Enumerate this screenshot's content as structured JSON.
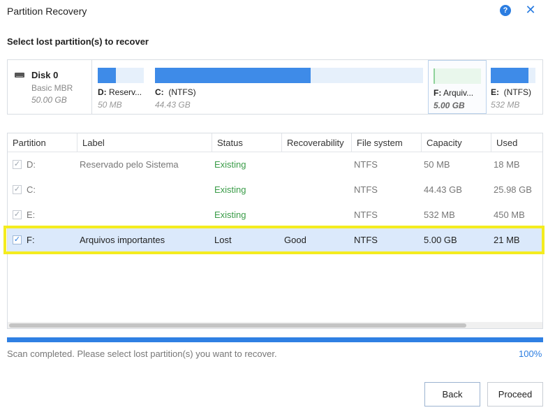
{
  "window": {
    "title": "Partition Recovery",
    "help_icon": "question-circle-icon",
    "close_icon": "close-icon",
    "accent_color": "#2b7de1"
  },
  "section_title": "Select lost partition(s) to recover",
  "disk": {
    "name": "Disk 0",
    "type": "Basic MBR",
    "size": "50.00 GB",
    "icon": "hard-disk-icon"
  },
  "disk_partitions": [
    {
      "letter": "D:",
      "name": "Reserv...",
      "size": "50 MB",
      "used_fraction": 0.4,
      "selected": false
    },
    {
      "letter": "C:",
      "name": "(NTFS)",
      "size": "44.43 GB",
      "used_fraction": 0.58,
      "selected": false
    },
    {
      "letter": "F:",
      "name": "Arquiv...",
      "size": "5.00 GB",
      "used_fraction": 0.03,
      "selected": true
    },
    {
      "letter": "E:",
      "name": "(NTFS)",
      "size": "532 MB",
      "used_fraction": 0.85,
      "selected": false
    }
  ],
  "table": {
    "columns": [
      "Partition",
      "Label",
      "Status",
      "Recoverability",
      "File system",
      "Capacity",
      "Used"
    ],
    "rows": [
      {
        "partition": "D:",
        "label": "Reservado pelo Sistema",
        "status": "Existing",
        "recoverability": "",
        "file_system": "NTFS",
        "capacity": "50 MB",
        "used": "18 MB",
        "checked": true,
        "selected": false
      },
      {
        "partition": "C:",
        "label": "",
        "status": "Existing",
        "recoverability": "",
        "file_system": "NTFS",
        "capacity": "44.43 GB",
        "used": "25.98 GB",
        "checked": true,
        "selected": false
      },
      {
        "partition": "E:",
        "label": "",
        "status": "Existing",
        "recoverability": "",
        "file_system": "NTFS",
        "capacity": "532 MB",
        "used": "450 MB",
        "checked": true,
        "selected": false
      },
      {
        "partition": "F:",
        "label": "Arquivos importantes",
        "status": "Lost",
        "recoverability": "Good",
        "file_system": "NTFS",
        "capacity": "5.00 GB",
        "used": "21 MB",
        "checked": true,
        "selected": true
      }
    ],
    "check_mark": "✓"
  },
  "progress": {
    "message": "Scan completed. Please select lost partition(s) you want to recover.",
    "percent_label": "100%",
    "fraction": 1.0
  },
  "buttons": {
    "back": "Back",
    "proceed": "Proceed"
  }
}
